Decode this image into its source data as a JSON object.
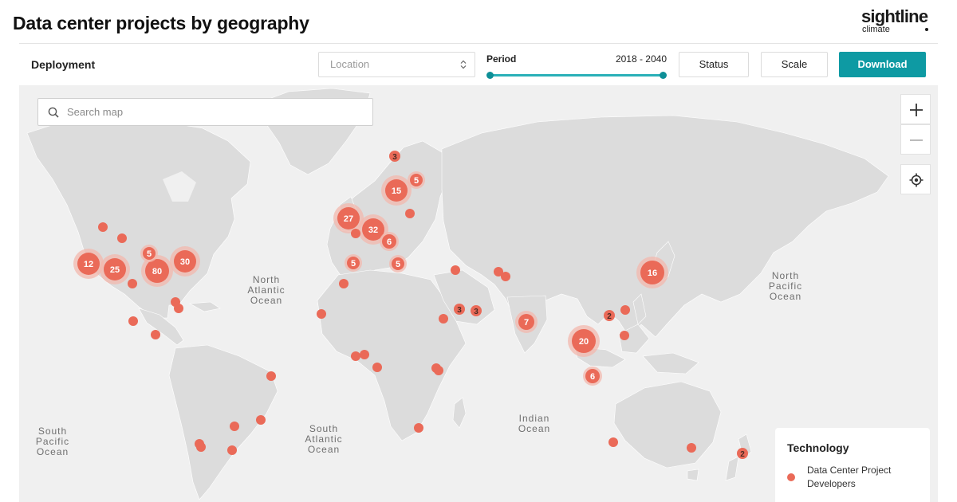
{
  "page": {
    "title": "Data center projects by geography"
  },
  "brand": {
    "name": "sightline",
    "sub": "climate"
  },
  "toolbar": {
    "title": "Deployment",
    "location_placeholder": "Location",
    "period_label": "Period",
    "period_range": "2018 - 2040",
    "status_label": "Status",
    "scale_label": "Scale",
    "download_label": "Download"
  },
  "search": {
    "placeholder": "Search map"
  },
  "ocean_labels": {
    "north_atlantic": "North\nAtlantic\nOcean",
    "north_pacific": "North\nPacific\nOcean",
    "south_pacific": "South\nPacific\nOcean",
    "south_atlantic": "South\nAtlantic\nOcean",
    "indian": "Indian\nOcean"
  },
  "legend": {
    "title": "Technology",
    "label": "Data Center Project Developers"
  },
  "colors": {
    "marker": "#ea6a58",
    "halo": "#f3b8ae",
    "accent": "#0e9aa3",
    "land": "#dcdcdc",
    "ocean": "#f0f0f0"
  },
  "icons": {
    "search": "search-icon",
    "zoom_in": "plus-icon",
    "zoom_out": "minus-icon",
    "locate": "locate-icon",
    "chevron": "chevron-down-icon",
    "select": "updown-icon"
  },
  "clusters": [
    {
      "label": "12",
      "region": "us-west-coast"
    },
    {
      "label": "25",
      "region": "us-west"
    },
    {
      "label": "80",
      "region": "us-central"
    },
    {
      "label": "30",
      "region": "us-east"
    },
    {
      "label": "5",
      "region": "us-mountain"
    },
    {
      "label": "27",
      "region": "uk-ireland"
    },
    {
      "label": "32",
      "region": "benelux-germany"
    },
    {
      "label": "15",
      "region": "scandinavia"
    },
    {
      "label": "5",
      "region": "finland"
    },
    {
      "label": "3",
      "region": "northern-norway"
    },
    {
      "label": "6",
      "region": "poland"
    },
    {
      "label": "5",
      "region": "iberia"
    },
    {
      "label": "5",
      "region": "italy-balkans"
    },
    {
      "label": "3",
      "region": "saudi-arabia"
    },
    {
      "label": "3",
      "region": "gulf"
    },
    {
      "label": "7",
      "region": "india"
    },
    {
      "label": "20",
      "region": "southeast-asia"
    },
    {
      "label": "6",
      "region": "indonesia"
    },
    {
      "label": "2",
      "region": "south-china"
    },
    {
      "label": "16",
      "region": "japan"
    },
    {
      "label": "2",
      "region": "new-zealand"
    }
  ]
}
